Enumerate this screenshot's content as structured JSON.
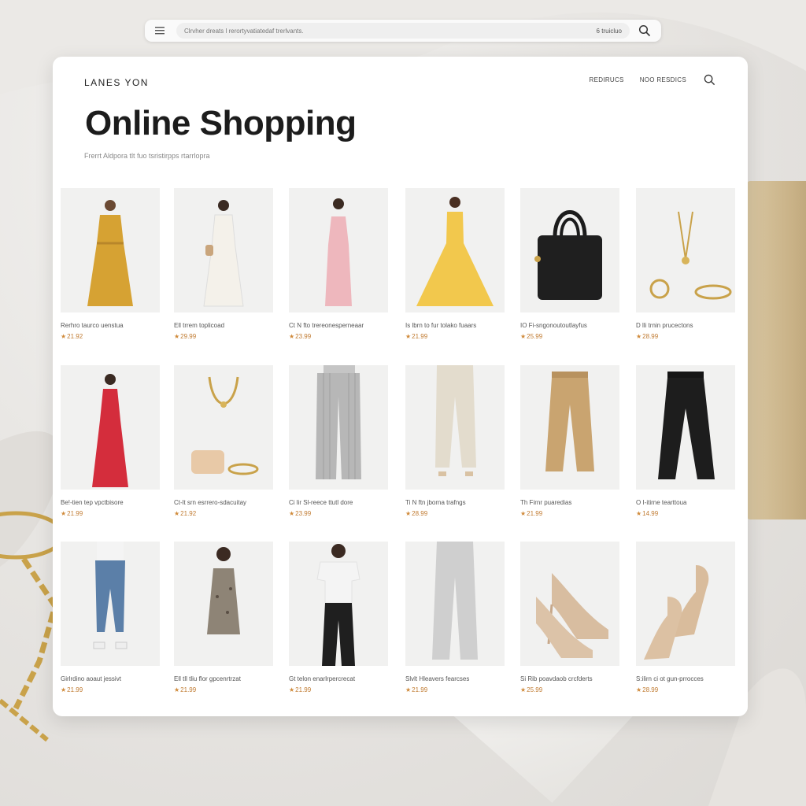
{
  "browser": {
    "url": "Clrvher dreats l rerortyvatiatedaf trerlvants.",
    "url_right": "6 truicluo",
    "menu_icon": "hamburger-icon",
    "search_icon": "search-icon"
  },
  "header": {
    "brand": "LANES YON",
    "nav": [
      "REDIRUCS",
      "NOO RESDICS"
    ],
    "search_icon": "search-icon"
  },
  "hero": {
    "title": "Online Shopping",
    "subtitle": "Frerrt Aldpora tlt fuo tsristirpps rtarrlopra"
  },
  "products": [
    {
      "name": "Rerhro taurco uenstua",
      "price": "21.92",
      "image": "mustard-maxi-dress"
    },
    {
      "name": "Ell trrem toplicoad",
      "price": "29.99",
      "image": "white-maxi-dress"
    },
    {
      "name": "Ct N fto trereonesperneaar",
      "price": "23.99",
      "image": "pink-maxi-dress"
    },
    {
      "name": "Is lbrn to fur tolako fuaars",
      "price": "21.99",
      "image": "yellow-gown"
    },
    {
      "name": "IO Fi-sngonoutoutlayfus",
      "price": "25.99",
      "image": "black-handbag"
    },
    {
      "name": "D lli trnin prucectons",
      "price": "28.99",
      "image": "gold-jewelry"
    },
    {
      "name": "Be!-tien tep vpctbisore",
      "price": "21.99",
      "image": "red-maxi-dress"
    },
    {
      "name": "Ct-lt srn esrrero-sdacuitay",
      "price": "21.92",
      "image": "necklace-and-bag"
    },
    {
      "name": "Ci lir Sl-reece ttutl dore",
      "price": "23.99",
      "image": "grey-pleated-pants"
    },
    {
      "name": "Ti N ftn jborna trafngs",
      "price": "28.99",
      "image": "cream-trousers"
    },
    {
      "name": "Th Firnr puaredias",
      "price": "21.99",
      "image": "tan-trousers"
    },
    {
      "name": "O I-itirne tearttoua",
      "price": "14.99",
      "image": "black-trousers"
    },
    {
      "name": "Girlrdino aoaut jessivt",
      "price": "21.99",
      "image": "blue-skinny-jeans"
    },
    {
      "name": "Ell tll tliu flor gpcenrtrzat",
      "price": "21.99",
      "image": "floral-slip-dress"
    },
    {
      "name": "Gt telon enarlrpercrecat",
      "price": "21.99",
      "image": "white-tee-black-pants"
    },
    {
      "name": "Slvlt Hleavers fearcses",
      "price": "21.99",
      "image": "grey-wide-jeans"
    },
    {
      "name": "Si Rib poavdaob crcfderts",
      "price": "25.99",
      "image": "nude-pumps"
    },
    {
      "name": "S:ilirn ci ot gun-prrocces",
      "price": "28.99",
      "image": "strappy-heels"
    }
  ]
}
